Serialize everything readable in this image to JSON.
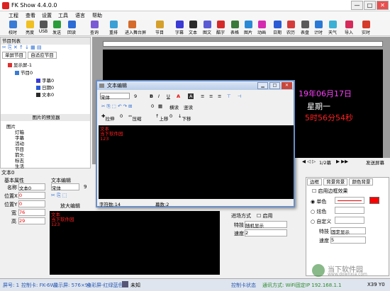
{
  "window": {
    "title": "FK Show 4.4.0.0",
    "minimize": "—",
    "maximize": "□",
    "close": "✕"
  },
  "menu": [
    "工程",
    "查看",
    "设置",
    "工具",
    "语言",
    "帮助"
  ],
  "toolbar": [
    {
      "label": "校时",
      "color": "#3a7bd5"
    },
    {
      "label": "亮度",
      "color": "#f0c020"
    },
    {
      "label": "USB",
      "color": "#555555"
    },
    {
      "label": "发送",
      "color": "#2a9d3a"
    },
    {
      "label": "回读",
      "color": "#2a6bd5"
    },
    {
      "label": "查询",
      "color": "#7a5ad5"
    },
    {
      "label": "重排",
      "color": "#3aa0d5"
    },
    {
      "label": "进入舞台屏",
      "color": "#d56a2a"
    },
    {
      "label": "节目",
      "color": "#d5a02a"
    },
    {
      "label": "字幕",
      "color": "#3a3ad5"
    },
    {
      "label": "文本",
      "color": "#2a2a2a"
    },
    {
      "label": "图文",
      "color": "#5a5ad5"
    },
    {
      "label": "酷字",
      "color": "#d52a2a"
    },
    {
      "label": "表格",
      "color": "#3a7a3a"
    },
    {
      "label": "图片",
      "color": "#2a8ad5"
    },
    {
      "label": "动画",
      "color": "#d52ab0"
    },
    {
      "label": "日期",
      "color": "#2a5ad5"
    },
    {
      "label": "农历",
      "color": "#d53a3a"
    },
    {
      "label": "表盘",
      "color": "#5a5a5a"
    },
    {
      "label": "计时",
      "color": "#2a7ad5"
    },
    {
      "label": "天气",
      "color": "#3ab0d5"
    },
    {
      "label": "导入",
      "color": "#d52a5a"
    },
    {
      "label": "实时",
      "color": "#d53a2a"
    }
  ],
  "program_list": {
    "header": "节目列表",
    "tabs": [
      "单屏节目",
      "自适应节目"
    ],
    "tree": [
      {
        "label": "显示屏-1",
        "color": "#e03030"
      },
      {
        "label": "节目0",
        "color": "#3a7bd5"
      },
      {
        "label": "字幕0",
        "color": "#3a3ad5"
      },
      {
        "label": "日期0",
        "color": "#2a5ad5"
      },
      {
        "label": "文本0",
        "color": "#2a2a2a"
      }
    ]
  },
  "image_browser": {
    "header": "图片的预览器",
    "items": [
      "图片",
      "灯箱",
      "字幕",
      "活动",
      "节目",
      "箭头",
      "标志",
      "生活"
    ]
  },
  "led": {
    "date": "19年06月17日",
    "weekday": "星期一",
    "time": "5时56分54秒",
    "pager": "1/2幕",
    "send_screen_label": "发送屏幕"
  },
  "dialog": {
    "title": "文本编辑",
    "font": "宋体",
    "size": "9",
    "bold": "B",
    "italic": "I",
    "underline": "U",
    "horizontal": "横读",
    "vertical": "竖读",
    "stretch_label": "拉伸",
    "stretch_value": "0",
    "compress_label": "压缩",
    "up_label": "上移",
    "up_value": "0",
    "down_label": "下移",
    "content": [
      "文本",
      "当下软件园",
      "123"
    ],
    "char_count": "字符数:14",
    "screen_count": "幕数:2"
  },
  "text_props": {
    "header": "文本0",
    "basic": "基本属性",
    "name_label": "名称",
    "name_value": "文本0",
    "pos_x_label": "位置X",
    "pos_x": "0",
    "pos_y_label": "位置Y",
    "pos_y": "0",
    "width_label": "宽",
    "width": "76",
    "height_label": "高",
    "height": "29",
    "edit_label": "文本编辑",
    "font": "宋体",
    "size": "9",
    "enlarge": "放大编辑",
    "content": [
      "文本",
      "当下软件园",
      "123"
    ]
  },
  "effects": {
    "play_mode": "进场方式",
    "enable": "启用",
    "special": "特技",
    "special_value": "随机显示",
    "speed": "速度",
    "speed_value": "2"
  },
  "border": {
    "tabs": [
      "边框",
      "背景背景",
      "颜色背景"
    ],
    "enable": "启用边框效果",
    "single": "单色",
    "flower": "炫色",
    "custom": "自定义",
    "special": "特技",
    "special_value": "固定显示",
    "speed": "速度",
    "speed_value": "5"
  },
  "status": {
    "screen": "屏号: 1",
    "card": "控制卡: FK-6W8",
    "display": "显示屏: 576×96",
    "color": "全彩屏-红绿蓝色",
    "unknown": "未知",
    "ctrl_status": "控制卡状态",
    "comm": "通讯方式: WiFi固定IP 192.168.1.1",
    "coords": "X39 Y0"
  },
  "watermark": {
    "name": "当下软件园",
    "url": "www.downxia.com"
  }
}
